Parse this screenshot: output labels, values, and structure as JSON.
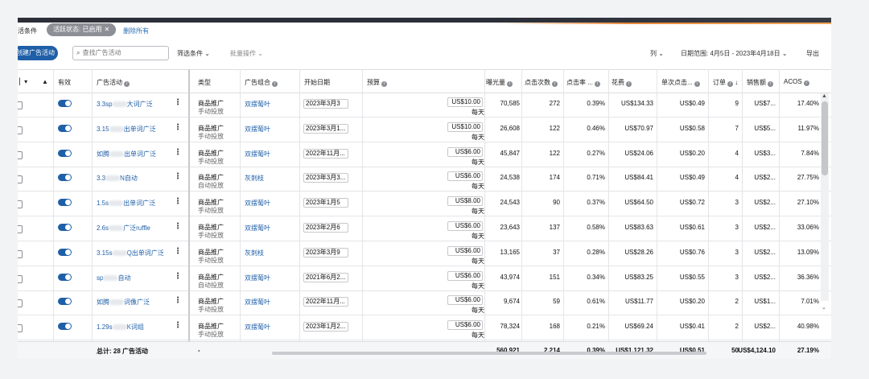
{
  "filters": {
    "label": "活条件",
    "chip": "活跃状态: 已启用",
    "chip_close": "✕",
    "clear_all": "删除所有"
  },
  "toolbar": {
    "create_button": "创建广告活动",
    "search_placeholder": "查找广告活动",
    "filter_label": "筛选条件",
    "bulk_label": "批量操作",
    "columns_label": "列",
    "date_range": "日期范围: 4月5日 - 2023年4月18日",
    "export_label": "导出"
  },
  "headers": {
    "enabled": "有效",
    "campaign": "广告活动",
    "type": "类型",
    "portfolio": "广告组合",
    "start_date": "开始日期",
    "budget": "预算",
    "impressions": "曝光量",
    "clicks": "点击次数",
    "ctr": "点击率 ...",
    "spend": "花费",
    "cpc": "单次点击...",
    "orders": "订单",
    "sales": "销售额",
    "acos": "ACOS"
  },
  "rows": [
    {
      "campaign_a": "3.3sp",
      "campaign_b": "大词广泛",
      "type1": "商品推广",
      "type2": "手动投放",
      "portfolio": "双摆葡叶",
      "start": "2023年3月3日",
      "budget": "US$10.00",
      "unit": "每天",
      "impressions": "70,585",
      "clicks": "272",
      "ctr": "0.39%",
      "spend": "US$134.33",
      "cpc": "US$0.49",
      "orders": "9",
      "sales": "US$7...",
      "acos": "17.40%"
    },
    {
      "campaign_a": "3.15",
      "campaign_b": "出单词广泛",
      "type1": "商品推广",
      "type2": "手动投放",
      "portfolio": "双摆葡叶",
      "start": "2023年3月1...",
      "budget": "US$10.00",
      "unit": "每天",
      "impressions": "26,608",
      "clicks": "122",
      "ctr": "0.46%",
      "spend": "US$70.97",
      "cpc": "US$0.58",
      "orders": "7",
      "sales": "US$5...",
      "acos": "11.97%"
    },
    {
      "campaign_a": "如腾",
      "campaign_b": "出单词广泛",
      "type1": "商品推广",
      "type2": "手动投放",
      "portfolio": "双摆葡叶",
      "start": "2022年11月...",
      "budget": "US$6.00",
      "unit": "每天",
      "impressions": "45,847",
      "clicks": "122",
      "ctr": "0.27%",
      "spend": "US$24.06",
      "cpc": "US$0.20",
      "orders": "4",
      "sales": "US$3...",
      "acos": "7.84%"
    },
    {
      "campaign_a": "3.3",
      "campaign_b": "N自动",
      "type1": "商品推广",
      "type2": "自动投放",
      "portfolio": "灰刺枝",
      "start": "2023年3月3...",
      "budget": "US$6.00",
      "unit": "每天",
      "impressions": "24,538",
      "clicks": "174",
      "ctr": "0.71%",
      "spend": "US$84.41",
      "cpc": "US$0.49",
      "orders": "4",
      "sales": "US$2...",
      "acos": "27.75%"
    },
    {
      "campaign_a": "1.5s",
      "campaign_b": "出单词广泛",
      "type1": "商品推广",
      "type2": "手动投放",
      "portfolio": "双摆葡叶",
      "start": "2023年1月5日",
      "budget": "US$8.00",
      "unit": "每天",
      "impressions": "24,543",
      "clicks": "90",
      "ctr": "0.37%",
      "spend": "US$64.50",
      "cpc": "US$0.72",
      "orders": "3",
      "sales": "US$2...",
      "acos": "27.10%"
    },
    {
      "campaign_a": "2.6s",
      "campaign_b": "广泛ruffle",
      "type1": "商品推广",
      "type2": "手动投放",
      "portfolio": "双摆葡叶",
      "start": "2023年2月6日",
      "budget": "US$6.00",
      "unit": "每天",
      "impressions": "23,643",
      "clicks": "137",
      "ctr": "0.58%",
      "spend": "US$83.63",
      "cpc": "US$0.61",
      "orders": "3",
      "sales": "US$2...",
      "acos": "33.06%"
    },
    {
      "campaign_a": "3.15s",
      "campaign_b": "Q出单词广泛",
      "type1": "商品推广",
      "type2": "手动投放",
      "portfolio": "灰刺枝",
      "start": "2023年3月9日",
      "budget": "US$6.00",
      "unit": "每天",
      "impressions": "13,165",
      "clicks": "37",
      "ctr": "0.28%",
      "spend": "US$28.26",
      "cpc": "US$0.76",
      "orders": "3",
      "sales": "US$2...",
      "acos": "13.09%"
    },
    {
      "campaign_a": "sp",
      "campaign_b": "自动",
      "type1": "商品推广",
      "type2": "自动投放",
      "portfolio": "双摆葡叶",
      "start": "2021年6月2...",
      "budget": "US$6.00",
      "unit": "每天",
      "impressions": "43,974",
      "clicks": "151",
      "ctr": "0.34%",
      "spend": "US$83.25",
      "cpc": "US$0.55",
      "orders": "3",
      "sales": "US$2...",
      "acos": "36.36%"
    },
    {
      "campaign_a": "如腾",
      "campaign_b": "词像广泛",
      "type1": "商品推广",
      "type2": "手动投放",
      "portfolio": "双摆葡叶",
      "start": "2022年11月...",
      "budget": "US$6.00",
      "unit": "每天",
      "impressions": "9,674",
      "clicks": "59",
      "ctr": "0.61%",
      "spend": "US$11.77",
      "cpc": "US$0.20",
      "orders": "2",
      "sales": "US$1...",
      "acos": "7.01%"
    },
    {
      "campaign_a": "1.29s",
      "campaign_b": "K词组",
      "type1": "商品推广",
      "type2": "手动投放",
      "portfolio": "双摆葡叶",
      "start": "2023年1月2...",
      "budget": "US$6.00",
      "unit": "每天",
      "impressions": "78,324",
      "clicks": "168",
      "ctr": "0.21%",
      "spend": "US$69.24",
      "cpc": "US$0.41",
      "orders": "2",
      "sales": "US$2...",
      "acos": "40.98%"
    }
  ],
  "totals": {
    "label": "总计: 28 广告活动",
    "type": "-",
    "impressions": "560,921",
    "clicks": "2,214",
    "ctr": "0.39%",
    "spend": "US$1,121.32",
    "cpc": "US$0.51",
    "orders": "50",
    "sales": "US$4,124.10",
    "acos": "27.19%"
  },
  "colors": {
    "accent": "#1f5fa8",
    "chip": "#8c8f96"
  }
}
